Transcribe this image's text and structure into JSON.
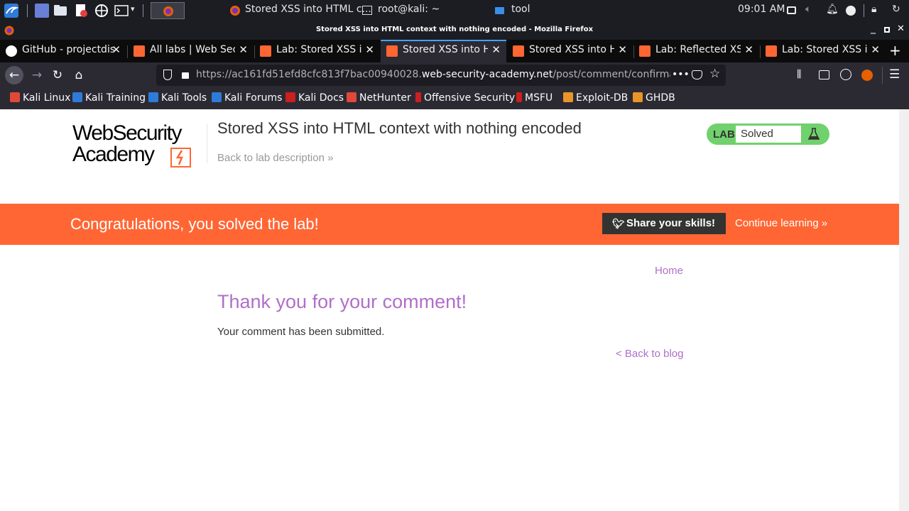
{
  "taskbar": {
    "windows": [
      {
        "label": "Stored XSS into HTML c..."
      },
      {
        "label": "root@kali: ~"
      },
      {
        "label": "tool"
      }
    ],
    "clock": "09:01 AM"
  },
  "window": {
    "title": "Stored XSS into HTML context with nothing encoded - Mozilla Firefox"
  },
  "tabs": [
    {
      "label": "GitHub - projectdisc"
    },
    {
      "label": "All labs | Web Secur"
    },
    {
      "label": "Lab: Stored XSS int"
    },
    {
      "label": "Stored XSS into HTI"
    },
    {
      "label": "Stored XSS into HT"
    },
    {
      "label": "Lab: Reflected XSS i"
    },
    {
      "label": "Lab: Stored XSS int"
    }
  ],
  "urlbar": {
    "prefix": "https://ac161fd51efd8cfc813f7bac00940028.",
    "domain": "web-security-academy.net",
    "path": "/post/comment/confirmation?p",
    "more": "•••"
  },
  "bookmarks": [
    {
      "label": "Kali Linux",
      "color": "#e0483a"
    },
    {
      "label": "Kali Training",
      "color": "#2f7bd9"
    },
    {
      "label": "Kali Tools",
      "color": "#2f7bd9"
    },
    {
      "label": "Kali Forums",
      "color": "#2f7bd9"
    },
    {
      "label": "Kali Docs",
      "color": "#cc1f1f"
    },
    {
      "label": "NetHunter",
      "color": "#e0483a"
    },
    {
      "label": "Offensive Security",
      "color": "#cc1f1f"
    },
    {
      "label": "MSFU",
      "color": "#cc1f1f"
    },
    {
      "label": "Exploit-DB",
      "color": "#e8952a"
    },
    {
      "label": "GHDB",
      "color": "#e8952a"
    }
  ],
  "page": {
    "logo_line1": "WebSecurity",
    "logo_line2": "Academy",
    "lab_title": "Stored XSS into HTML context with nothing encoded",
    "back_to_description": "Back to lab description »",
    "badge_lab": "LAB",
    "badge_status": "Solved",
    "congrats_message": "Congratulations, you solved the lab!",
    "share_button": "Share your skills!",
    "continue_learning": "Continue learning »",
    "home_link": "Home",
    "thanks_heading": "Thank you for your comment!",
    "submitted_text": "Your comment has been submitted.",
    "back_to_blog": "< Back to blog"
  },
  "colors": {
    "accent_orange": "#ff6633",
    "solved_green": "#70d16d",
    "link_purple": "#b06fc8",
    "firefox_tab_highlight": "#45a1ff"
  }
}
